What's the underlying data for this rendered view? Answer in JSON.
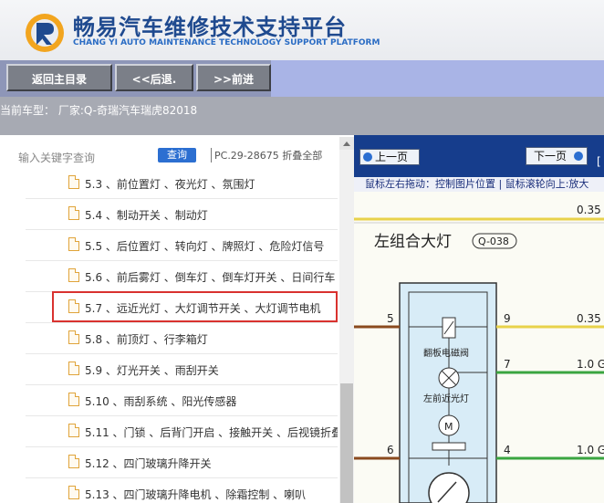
{
  "header": {
    "title": "畅易汽车维修技术支持平台",
    "subtitle": "CHANG YI AUTO MAINTENANCE TECHNOLOGY SUPPORT PLATFORM"
  },
  "toolbar": {
    "home_label": "返回主目录",
    "back_label": "<<后退.",
    "forward_label": ">>前进"
  },
  "vehicle": {
    "line": "当前车型：  厂家:Q-奇瑞汽车瑞虎82018"
  },
  "search": {
    "placeholder": "输入关键字查询",
    "button_label": "查询",
    "pc_text": "PC.29-28675 折叠全部"
  },
  "tree": {
    "items": [
      {
        "label": "5.3 、前位置灯 、夜光灯 、氛围灯"
      },
      {
        "label": "5.4 、制动开关 、制动灯"
      },
      {
        "label": "5.5 、后位置灯 、转向灯 、牌照灯 、危险灯信号"
      },
      {
        "label": "5.6 、前后雾灯 、倒车灯 、倒车灯开关 、日间行车"
      },
      {
        "label": "5.7 、远近光灯 、大灯调节开关 、大灯调节电机"
      },
      {
        "label": "5.8 、前顶灯 、行李箱灯"
      },
      {
        "label": "5.9 、灯光开关 、雨刮开关"
      },
      {
        "label": "5.10 、雨刮系统 、阳光传感器"
      },
      {
        "label": "5.11 、门锁 、后背门开启 、接触开关 、后视镜折叠"
      },
      {
        "label": "5.12 、四门玻璃升降开关"
      },
      {
        "label": "5.13 、四门玻璃升降电机 、除霜控制 、喇叭"
      }
    ],
    "selected_index": 4
  },
  "viewer": {
    "prev_label": "上一页",
    "next_label": "下一页",
    "bracket": "[",
    "hint": "鼠标左右拖动：控制图片位置 | 鼠标滚轮向上:放大",
    "diagram": {
      "title": "左组合大灯",
      "code": "Q-038",
      "top_value": "0.35",
      "pins": [
        {
          "left_pin": "5",
          "right_pin": "9",
          "wire": "0.35"
        },
        {
          "right_pin": "7",
          "wire": "1.0 G"
        },
        {
          "left_pin": "6",
          "right_pin": "4",
          "wire": "1.0 G"
        }
      ],
      "labels": [
        "翻板电磁阀",
        "左前近光灯"
      ],
      "motor_label": "M"
    }
  }
}
